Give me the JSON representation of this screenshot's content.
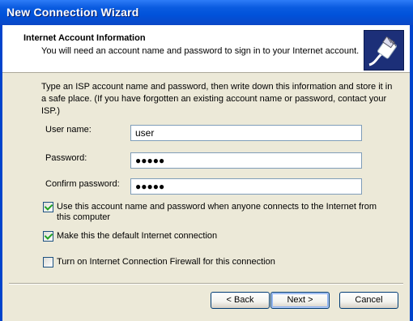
{
  "window": {
    "title": "New Connection Wizard"
  },
  "header": {
    "title": "Internet Account Information",
    "subtitle": "You will need an account name and password to sign in to your Internet account.",
    "icon": "network-cable-icon"
  },
  "intro": "Type an ISP account name and password, then write down this information and store it in a safe place. (If you have forgotten an existing account name or password, contact your ISP.)",
  "form": {
    "username_label": "User name:",
    "username_value": "user",
    "password_label": "Password:",
    "password_value": "●●●●●",
    "confirm_label": "Confirm password:",
    "confirm_value": "●●●●●"
  },
  "options": [
    {
      "label": "Use this account  name and password when anyone connects to the Internet from this computer",
      "checked": true
    },
    {
      "label": "Make this the default Internet connection",
      "checked": true
    },
    {
      "label": "Turn on Internet Connection Firewall for this connection",
      "checked": false
    }
  ],
  "buttons": {
    "back": "< Back",
    "next": "Next >",
    "cancel": "Cancel"
  }
}
